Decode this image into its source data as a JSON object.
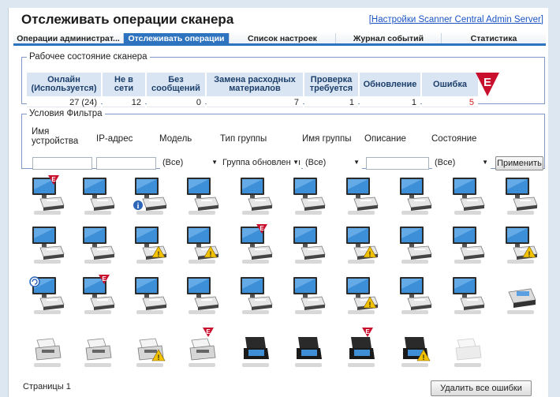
{
  "title": "Отслеживать операции сканера",
  "admin_link": "[Настройки Scanner Central Admin Server]",
  "tabs": [
    {
      "label": "Операции администрат...",
      "active": false
    },
    {
      "label": "Отслеживать операции",
      "active": true
    },
    {
      "label": "Список настроек",
      "active": false
    },
    {
      "label": "Журнал событий",
      "active": false
    },
    {
      "label": "Статистика",
      "active": false
    }
  ],
  "status": {
    "legend": "Рабочее состояние сканера",
    "columns": [
      {
        "line1": "Онлайн",
        "line2": "(Используется)",
        "value": "27 (24)"
      },
      {
        "line1": "Не в",
        "line2": "сети",
        "value": "12"
      },
      {
        "line1": "Без",
        "line2": "сообщений",
        "value": "0"
      },
      {
        "line1": "Замена расходных",
        "line2": "материалов",
        "value": "7"
      },
      {
        "line1": "Проверка",
        "line2": "требуется",
        "value": "1"
      },
      {
        "line1": "Обновление",
        "line2": "",
        "value": "1"
      },
      {
        "line1": "Ошибка",
        "line2": "",
        "value": "5"
      }
    ]
  },
  "filter": {
    "legend": "Условия Фильтра",
    "labels": {
      "device_name_1": "Имя",
      "device_name_2": "устройства",
      "ip": "IP-адрес",
      "model": "Модель",
      "group_type": "Тип группы",
      "group_name": "Имя группы",
      "description": "Описание",
      "state": "Состояние"
    },
    "model_value": "(Все)",
    "group_type_value": "Группа обновления",
    "group_name_value": "(Все)",
    "state_value": "(Все)",
    "apply_label": "Применить"
  },
  "devices": [
    [
      "monitor-scanner-error",
      "monitor-scanner",
      "monitor-scanner-info",
      "monitor-scanner",
      "monitor-scanner",
      "monitor-scanner",
      "monitor-scanner",
      "monitor-scanner",
      "monitor-scanner",
      "monitor-scanner"
    ],
    [
      "monitor-scanner",
      "monitor-scanner",
      "monitor-scanner-warning",
      "monitor-scanner-warning",
      "monitor-scanner-error",
      "monitor-scanner",
      "monitor-scanner-warning",
      "monitor-scanner",
      "monitor-scanner",
      "monitor-scanner-warning"
    ],
    [
      "monitor-scanner-update",
      "monitor-scanner-error",
      "monitor-scanner",
      "monitor-scanner",
      "monitor-scanner",
      "monitor-scanner",
      "monitor-scanner-warning",
      "monitor-scanner",
      "monitor-scanner",
      "scanner-desk"
    ],
    [
      "scanner-sheetfed",
      "scanner-sheetfed",
      "scanner-sheetfed-warning",
      "scanner-sheetfed-error",
      "scanner-black",
      "scanner-black",
      "scanner-black-error",
      "scanner-black-warning",
      "scanner-offline",
      ""
    ]
  ],
  "footer": {
    "pages": "Страницы 1",
    "clear_errors": "Удалить все ошибки"
  },
  "colors": {
    "accent": "#2e73bf",
    "error": "#c8102e",
    "warning": "#f2c200",
    "info": "#2d66b8"
  }
}
